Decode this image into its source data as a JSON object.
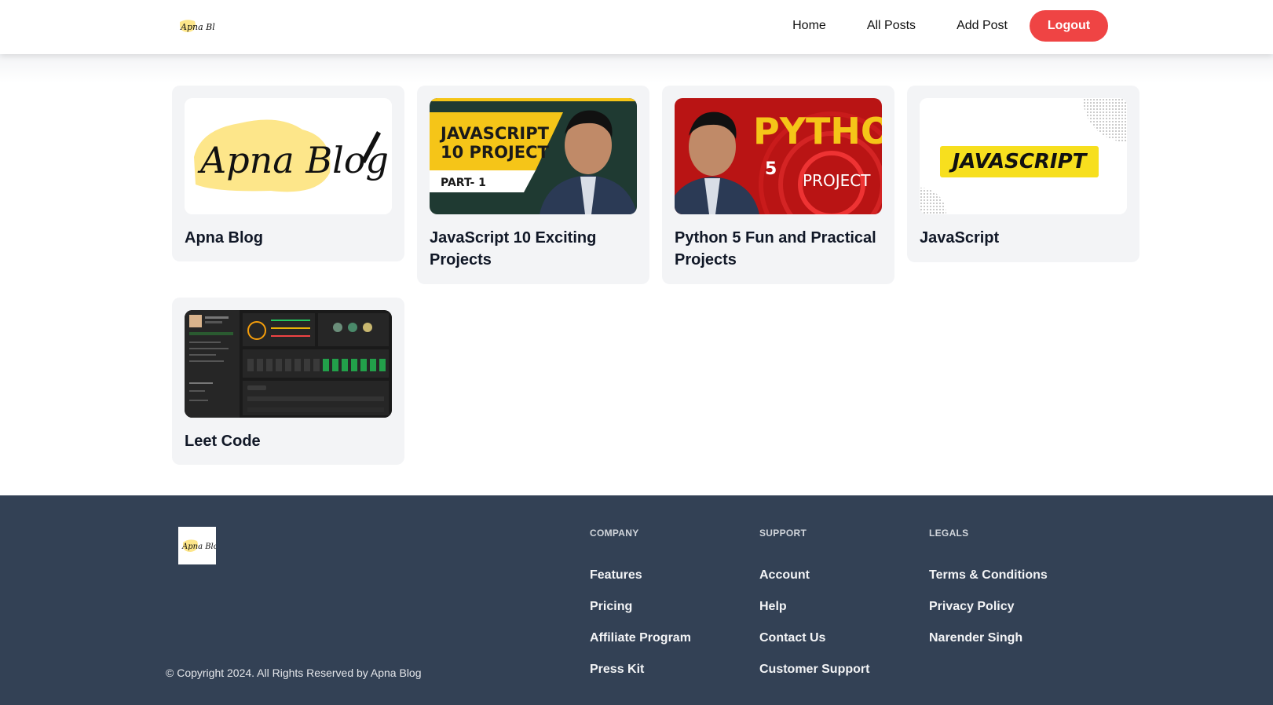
{
  "header": {
    "logo_text": "Apna Blog",
    "nav": [
      "Home",
      "All Posts",
      "Add Post"
    ],
    "logout_label": "Logout"
  },
  "posts": [
    {
      "title": "Apna Blog",
      "thumb_text": "Apna Blog"
    },
    {
      "title": "JavaScript 10 Exciting Projects",
      "thumb_lines": [
        "JAVASCRIPT",
        "10 PROJECT"
      ],
      "thumb_sub": "PART- 1"
    },
    {
      "title": "Python 5 Fun and Practical Projects",
      "thumb_main": "PYTHON",
      "thumb_num": "5",
      "thumb_sub": "PROJECT"
    },
    {
      "title": "JavaScript",
      "thumb_text": "JAVASCRIPT"
    },
    {
      "title": "Leet Code"
    }
  ],
  "footer": {
    "logo_text": "Apna Blog",
    "copyright": "© Copyright 2024. All Rights Reserved by Apna Blog",
    "columns": [
      {
        "heading": "COMPANY",
        "links": [
          "Features",
          "Pricing",
          "Affiliate Program",
          "Press Kit"
        ]
      },
      {
        "heading": "SUPPORT",
        "links": [
          "Account",
          "Help",
          "Contact Us",
          "Customer Support"
        ]
      },
      {
        "heading": "LEGALS",
        "links": [
          "Terms & Conditions",
          "Privacy Policy",
          "Narender Singh"
        ]
      }
    ]
  },
  "colors": {
    "accent": "#ef4444",
    "footer_bg": "#334155",
    "card_bg": "#f3f4f6"
  }
}
